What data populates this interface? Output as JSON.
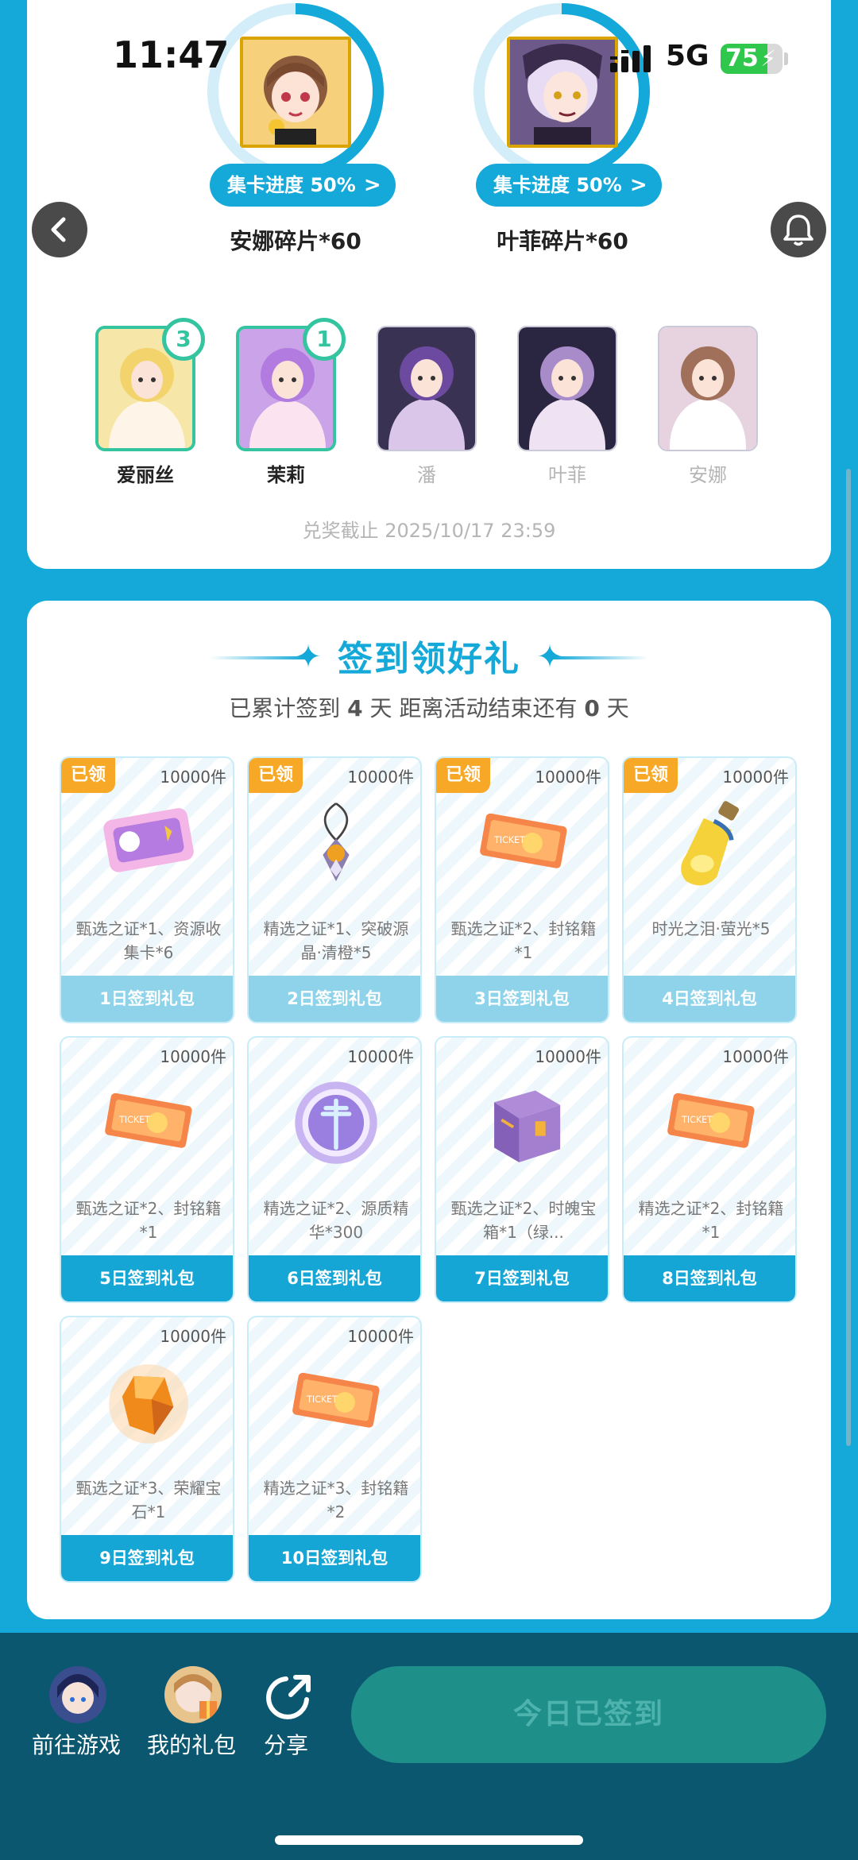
{
  "status_bar": {
    "time": "11:47",
    "network": "5G",
    "battery_level": "75",
    "battery_fraction": 0.75
  },
  "collect": {
    "cards": [
      {
        "name": "安娜碎片*60",
        "progress_label": "集卡进度 50%",
        "progress": 0.5,
        "avatar_icon": "anna-avatar"
      },
      {
        "name": "叶菲碎片*60",
        "progress_label": "集卡进度 50%",
        "progress": 0.5,
        "avatar_icon": "yefei-avatar"
      }
    ],
    "characters": [
      {
        "name": "爱丽丝",
        "badge": "3",
        "selected": true
      },
      {
        "name": "茉莉",
        "badge": "1",
        "selected": true
      },
      {
        "name": "潘",
        "badge": "",
        "selected": false
      },
      {
        "name": "叶菲",
        "badge": "",
        "selected": false
      },
      {
        "name": "安娜",
        "badge": "",
        "selected": false
      }
    ],
    "deadline": "兑奖截止 2025/10/17 23:59"
  },
  "signin": {
    "title": "签到领好礼",
    "subtitle_prefix": "已累计签到",
    "days_signed": "4",
    "subtitle_mid": "天  距离活动结束还有",
    "days_left": "0",
    "subtitle_suffix": "天",
    "gifts": [
      {
        "label": "1日签到礼包",
        "desc": "甄选之证*1、资源收集卡*6",
        "count": "10000件",
        "claimed": "已领",
        "icon": "card-icon"
      },
      {
        "label": "2日签到礼包",
        "desc": "精选之证*1、突破源晶·清橙*5",
        "count": "10000件",
        "claimed": "已领",
        "icon": "crystal-pendant-icon"
      },
      {
        "label": "3日签到礼包",
        "desc": "甄选之证*2、封铭籍*1",
        "count": "10000件",
        "claimed": "已领",
        "icon": "ticket-icon"
      },
      {
        "label": "4日签到礼包",
        "desc": "时光之泪·萤光*5",
        "count": "10000件",
        "claimed": "已领",
        "icon": "potion-icon"
      },
      {
        "label": "5日签到礼包",
        "desc": "甄选之证*2、封铭籍*1",
        "count": "10000件",
        "claimed": "",
        "icon": "ticket-icon"
      },
      {
        "label": "6日签到礼包",
        "desc": "精选之证*2、源质精华*300",
        "count": "10000件",
        "claimed": "",
        "icon": "emblem-icon"
      },
      {
        "label": "7日签到礼包",
        "desc": "甄选之证*2、时魄宝箱*1（绿...",
        "count": "10000件",
        "claimed": "",
        "icon": "chest-icon"
      },
      {
        "label": "8日签到礼包",
        "desc": "精选之证*2、封铭籍*1",
        "count": "10000件",
        "claimed": "",
        "icon": "ticket-icon"
      },
      {
        "label": "9日签到礼包",
        "desc": "甄选之证*3、荣耀宝石*1",
        "count": "10000件",
        "claimed": "",
        "icon": "gem-icon"
      },
      {
        "label": "10日签到礼包",
        "desc": "精选之证*3、封铭籍*2",
        "count": "10000件",
        "claimed": "",
        "icon": "ticket-icon"
      }
    ]
  },
  "bottom": {
    "go_game": "前往游戏",
    "my_gifts": "我的礼包",
    "share": "分享",
    "signed_button": "今日已签到"
  },
  "colors": {
    "accent": "#14a9d9",
    "claimed": "#f6a826",
    "select": "#35c4a0",
    "bottom_bg": "#0c5770"
  }
}
